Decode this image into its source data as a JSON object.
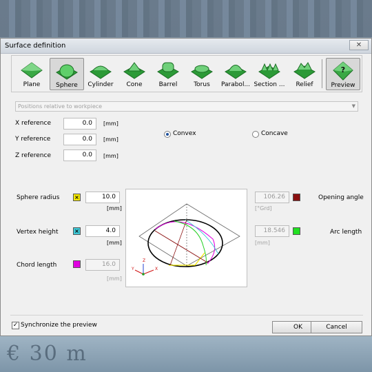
{
  "window": {
    "title": "Surface definition",
    "close_glyph": "✕"
  },
  "toolbar": {
    "tools": [
      {
        "label": "Plane",
        "icon": "plane-surface-icon"
      },
      {
        "label": "Sphere",
        "icon": "sphere-surface-icon",
        "selected": true
      },
      {
        "label": "Cylinder",
        "icon": "cylinder-surface-icon"
      },
      {
        "label": "Cone",
        "icon": "cone-surface-icon"
      },
      {
        "label": "Barrel",
        "icon": "barrel-surface-icon"
      },
      {
        "label": "Torus",
        "icon": "torus-surface-icon"
      },
      {
        "label": "Parabol...",
        "icon": "paraboloid-surface-icon"
      },
      {
        "label": "Section ...",
        "icon": "section-surface-icon"
      },
      {
        "label": "Relief",
        "icon": "relief-surface-icon"
      }
    ],
    "preview": {
      "label": "Preview",
      "glyph": "?",
      "icon": "preview-help-icon",
      "selected": true
    }
  },
  "positions": {
    "value": "Positions relative to workpiece"
  },
  "reference": {
    "x": {
      "label": "X reference",
      "value": "0.0",
      "unit": "[mm]"
    },
    "y": {
      "label": "Y reference",
      "value": "0.0",
      "unit": "[mm]"
    },
    "z": {
      "label": "Z reference",
      "value": "0.0",
      "unit": "[mm]"
    }
  },
  "shape": {
    "convex": "Convex",
    "concave": "Concave",
    "selected": "convex"
  },
  "sphere": {
    "radius": {
      "label": "Sphere radius",
      "marker": "×",
      "value": "10.0",
      "unit": "[mm]",
      "color": "#f2e600"
    },
    "vertex": {
      "label": "Vertex height",
      "marker": "×",
      "value": "4.0",
      "unit": "[mm]",
      "color": "#3ec8d6"
    },
    "chord": {
      "label": "Chord length",
      "value": "16.0",
      "unit": "[mm]",
      "color": "#e000e0"
    }
  },
  "angles": {
    "opening": {
      "label": "Opening angle",
      "value": "106.26",
      "unit": "[°Grd]",
      "color": "#8b1010"
    },
    "arc": {
      "label": "Arc length",
      "value": "18.546",
      "unit": "[mm]",
      "color": "#22e022"
    }
  },
  "preview_axes": {
    "x": "X",
    "y": "Y",
    "z": "Z"
  },
  "footer": {
    "sync_label": "Synchronize the preview",
    "sync_checked": true,
    "ok": "OK",
    "cancel": "Cancel"
  },
  "colors": {
    "accent_green": "#2fa83a",
    "dialog_bg": "#f0f0f0"
  }
}
